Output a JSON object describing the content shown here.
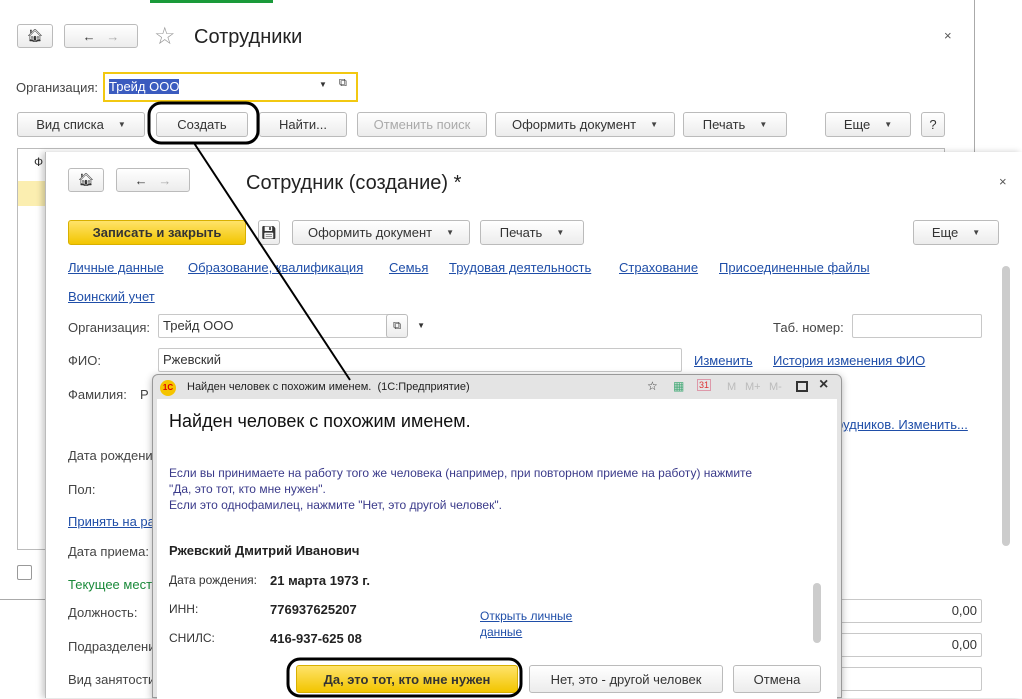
{
  "list_window": {
    "title": "Сотрудники",
    "org_label": "Организация:",
    "org_value": "Трейд ООО",
    "buttons": {
      "view": "Вид списка",
      "create": "Создать",
      "find": "Найти...",
      "cancel_search": "Отменить поиск",
      "make_doc": "Оформить документ",
      "print": "Печать",
      "more": "Еще",
      "help": "?"
    },
    "column_first": "Ф"
  },
  "form": {
    "title": "Сотрудник (создание) *",
    "buttons": {
      "save_close": "Записать и закрыть",
      "make_doc": "Оформить документ",
      "print": "Печать",
      "more": "Еще"
    },
    "tabs": [
      "Личные данные",
      "Образование, квалификация",
      "Семья",
      "Трудовая деятельность",
      "Страхование",
      "Присоединенные файлы",
      "Воинский учет"
    ],
    "org_label": "Организация:",
    "org_value": "Трейд ООО",
    "tab_num_label": "Таб. номер:",
    "tab_num_value": "",
    "fio_label": "ФИО:",
    "fio_value": "Ржевский",
    "change_link": "Изменить",
    "history_link": "История изменения ФИО",
    "surname_label": "Фамилия:",
    "surname_value": "Р",
    "employees_link": "рудников. Изменить...",
    "birth_label": "Дата рождени",
    "gender_label": "Пол:",
    "hire_link": "Принять на ра",
    "hire_date_label": "Дата приема:",
    "current_place": "Текущее мест",
    "position_label": "Должность:",
    "position_value": "0,00",
    "dept_label": "Подразделени",
    "dept_value": "0,00",
    "employment_label": "Вид занятости"
  },
  "dialog": {
    "title": "Найден человек с похожим именем.  (1С:Предприятие)",
    "heading": "Найден человек с похожим именем.",
    "text1": "Если вы принимаете на работу того же человека (например, при повторном приеме на работу) нажмите",
    "text2": "\"Да, это тот, кто мне нужен\".",
    "text3": "Если это однофамилец, нажмите \"Нет, это другой человек\".",
    "person": "Ржевский Дмитрий Иванович",
    "birth_label": "Дата рождения:",
    "birth_value": "21 марта 1973 г.",
    "inn_label": "ИНН:",
    "inn_value": "776937625207",
    "snils_label": "СНИЛС:",
    "snils_value": "416-937-625 08",
    "open_link": "Открыть личные данные",
    "toolbar": {
      "m": "M",
      "mplus": "M+",
      "mminus": "M-"
    },
    "buttons": {
      "yes": "Да, это тот, кто мне нужен",
      "no": "Нет, это - другой человек",
      "cancel": "Отмена"
    }
  }
}
